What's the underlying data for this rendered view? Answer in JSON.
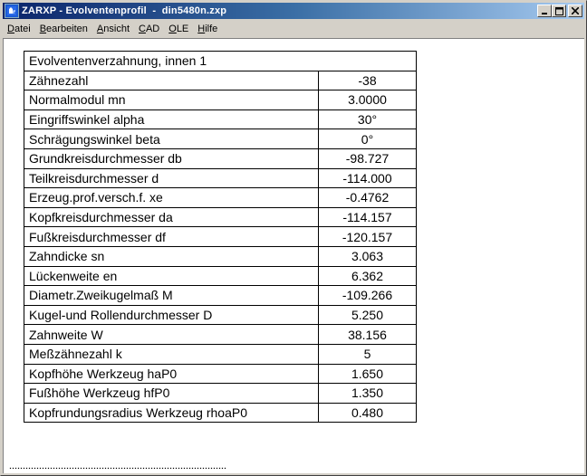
{
  "window": {
    "title": "ZARXP - Evolventenprofil  -  din5480n.zxp",
    "buttons": {
      "minimize": "_",
      "maximize": "□",
      "close": "X"
    }
  },
  "menu": [
    {
      "label": "Datei",
      "accel": "D",
      "rest": "atei"
    },
    {
      "label": "Bearbeiten",
      "accel": "B",
      "rest": "earbeiten"
    },
    {
      "label": "Ansicht",
      "accel": "A",
      "rest": "nsicht"
    },
    {
      "label": "CAD",
      "accel": "C",
      "rest": "AD"
    },
    {
      "label": "OLE",
      "accel": "O",
      "rest": "LE"
    },
    {
      "label": "Hilfe",
      "accel": "H",
      "rest": "ilfe"
    }
  ],
  "table": {
    "header": "Evolventenverzahnung, innen   1",
    "rows": [
      {
        "label": "Zähnezahl",
        "value": "-38"
      },
      {
        "label": "Normalmodul mn",
        "value": "3.0000"
      },
      {
        "label": "Eingriffswinkel alpha",
        "value": "30°"
      },
      {
        "label": "Schrägungswinkel beta",
        "value": "0°"
      },
      {
        "label": "Grundkreisdurchmesser db",
        "value": "-98.727"
      },
      {
        "label": "Teilkreisdurchmesser d",
        "value": "-114.000"
      },
      {
        "label": "Erzeug.prof.versch.f. xe",
        "value": "-0.4762"
      },
      {
        "label": "Kopfkreisdurchmesser da",
        "value": "-114.157"
      },
      {
        "label": "Fußkreisdurchmesser df",
        "value": "-120.157"
      },
      {
        "label": "Zahndicke sn",
        "value": "3.063"
      },
      {
        "label": "Lückenweite en",
        "value": "6.362"
      },
      {
        "label": "Diametr.Zweikugelmaß M",
        "value": "-109.266"
      },
      {
        "label": "Kugel-und Rollendurchmesser D",
        "value": "5.250"
      },
      {
        "label": "Zahnweite W",
        "value": "38.156"
      },
      {
        "label": "Meßzähnezahl k",
        "value": "5"
      },
      {
        "label": "Kopfhöhe Werkzeug haP0",
        "value": "1.650"
      },
      {
        "label": "Fußhöhe Werkzeug hfP0",
        "value": "1.350"
      },
      {
        "label": "Kopfrundungsradius Werkzeug rhoaP0",
        "value": "0.480"
      }
    ]
  }
}
